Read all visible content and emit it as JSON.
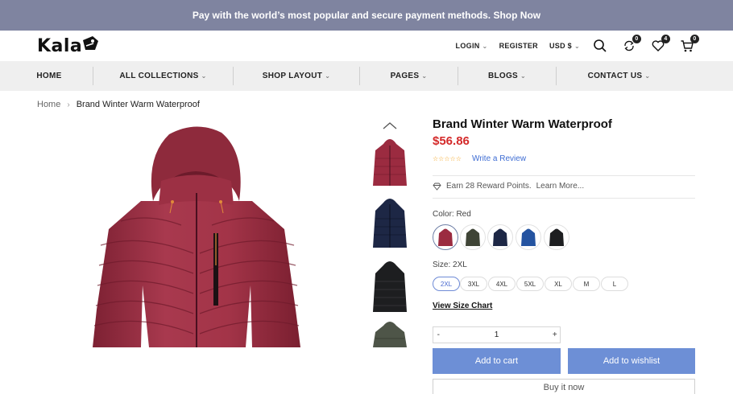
{
  "announcement": "Pay with the world’s most popular and secure payment methods. Shop Now",
  "logo": "Kala",
  "header": {
    "login": "LOGIN",
    "register": "REGISTER",
    "currency": "USD $",
    "compare_count": "0",
    "wishlist_count": "4",
    "cart_count": "0"
  },
  "nav": [
    "HOME",
    "ALL COLLECTIONS",
    "SHOP LAYOUT",
    "PAGES",
    "BLOGS",
    "CONTACT US"
  ],
  "breadcrumb": {
    "home": "Home",
    "current": "Brand Winter Warm Waterproof"
  },
  "product": {
    "title": "Brand Winter Warm Waterproof",
    "price": "$56.86",
    "review_link": "Write a Review",
    "reward_text": "Earn 28 Reward Points.",
    "learn_more": "Learn More...",
    "color_label": "Color: Red",
    "colors": [
      "Red",
      "Olive",
      "Navy",
      "Blue",
      "Black"
    ],
    "color_hex": [
      "#9b2b40",
      "#3f4436",
      "#1d2745",
      "#2453a0",
      "#1d1e20"
    ],
    "size_label": "Size: 2XL",
    "sizes": [
      "2XL",
      "3XL",
      "4XL",
      "5XL",
      "XL",
      "M",
      "L"
    ],
    "size_chart": "View Size Chart",
    "qty_minus": "-",
    "quantity": "1",
    "qty_plus": "+",
    "add_to_cart": "Add to cart",
    "add_to_wishlist": "Add to wishlist",
    "buy_now": "Buy it now"
  },
  "thumbnail_colors": [
    "#9b2b40",
    "#1d2745",
    "#1d1e20",
    "#4e5548"
  ]
}
